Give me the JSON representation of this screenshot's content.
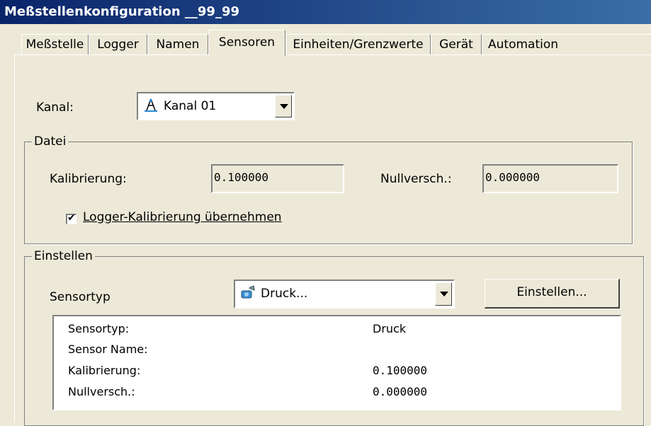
{
  "window": {
    "title": "Meßstellenkonfiguration __99_99"
  },
  "tabs": [
    {
      "label": "Meßstelle",
      "active": false
    },
    {
      "label": "Logger",
      "active": false
    },
    {
      "label": "Namen",
      "active": false
    },
    {
      "label": "Sensoren",
      "active": true
    },
    {
      "label": "Einheiten/Grenzwerte",
      "active": false
    },
    {
      "label": "Gerät",
      "active": false
    },
    {
      "label": "Automation",
      "active": false
    }
  ],
  "kanal": {
    "label": "Kanal:",
    "value": "Kanal 01",
    "icon": "probe-icon"
  },
  "datei": {
    "legend": "Datei",
    "kalibrierung_label": "Kalibrierung:",
    "kalibrierung_value": "0.100000",
    "nullversch_label": "Nullversch.:",
    "nullversch_value": "0.000000",
    "checkbox_label": "Logger-Kalibrierung übernehmen",
    "checkbox_checked": true
  },
  "einstellen": {
    "legend": "Einstellen",
    "sensortyp_label": "Sensortyp",
    "sensortyp_value": "Druck...",
    "sensortyp_icon": "pressure-sensor-icon",
    "button_label": "Einstellen...",
    "details": [
      {
        "key": "Sensortyp:",
        "value": "Druck"
      },
      {
        "key": "Sensor Name:",
        "value": ""
      },
      {
        "key": "Kalibrierung:",
        "value": "0.100000"
      },
      {
        "key": "Nullversch.:",
        "value": "0.000000"
      }
    ]
  }
}
